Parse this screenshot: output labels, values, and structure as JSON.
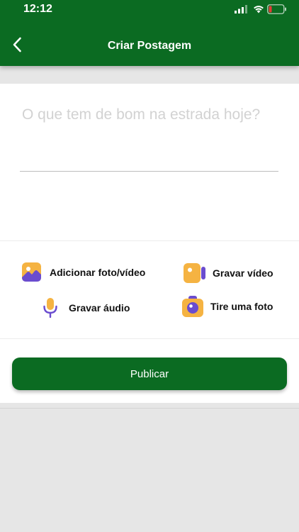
{
  "status_bar": {
    "time": "12:12"
  },
  "header": {
    "title": "Criar Postagem",
    "back_icon": "chevron-left-icon"
  },
  "post": {
    "value": "",
    "placeholder": "O que tem de bom na estrada hoje?"
  },
  "actions": [
    {
      "label": "Adicionar foto/vídeo",
      "icon": "image-icon"
    },
    {
      "label": "Gravar vídeo",
      "icon": "video-camera-icon"
    },
    {
      "label": "Gravar áudio",
      "icon": "microphone-icon"
    },
    {
      "label": "Tire uma foto",
      "icon": "camera-icon"
    }
  ],
  "publish_button": {
    "label": "Publicar"
  },
  "colors": {
    "brand_green": "#0b6b22",
    "icon_orange": "#f5b342",
    "icon_purple": "#6a4ccf",
    "battery_red": "#e53935"
  }
}
